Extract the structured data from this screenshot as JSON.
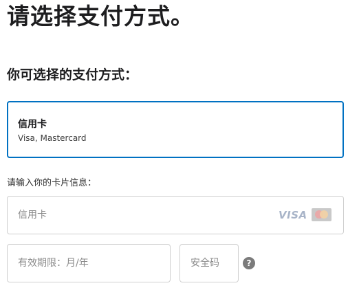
{
  "page": {
    "title": "请选择支付方式。"
  },
  "payment_methods": {
    "heading": "你可选择的支付方式：",
    "selected": {
      "title": "信用卡",
      "subtitle": "Visa, Mastercard"
    }
  },
  "card_form": {
    "label": "请输入你的卡片信息：",
    "card_number": {
      "placeholder": "信用卡",
      "value": ""
    },
    "brand_logos": [
      "VISA",
      "Mastercard"
    ],
    "expiry": {
      "placeholder": "有效期限：月/年",
      "value": ""
    },
    "cvc": {
      "placeholder": "安全码",
      "value": ""
    },
    "help_icon": {
      "glyph": "?",
      "icon": "question-circle-icon"
    }
  },
  "colors": {
    "accent": "#0071c2",
    "border": "#cfcfcf",
    "placeholder": "#8a8a8a"
  }
}
